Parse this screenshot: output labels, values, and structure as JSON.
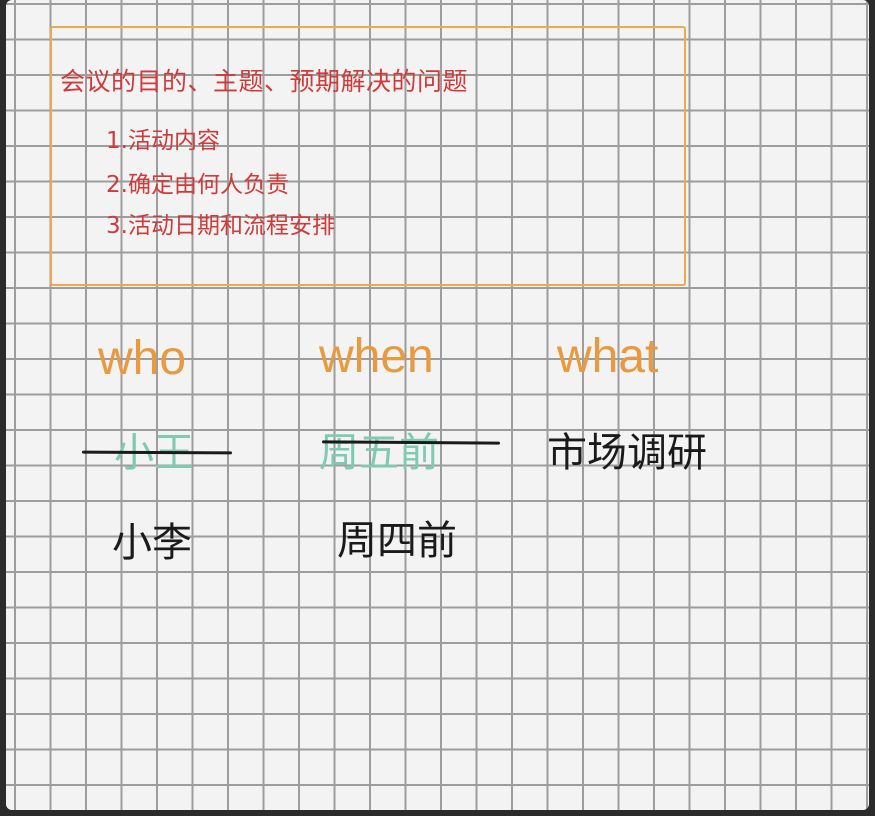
{
  "agenda": {
    "title": "会议的目的、主题、预期解决的问题",
    "items": [
      "1.活动内容",
      "2.确定由何人负责",
      "3.活动日期和流程安排"
    ]
  },
  "columns": {
    "who": "who",
    "when": "when",
    "what": "what"
  },
  "entries": {
    "who_old": "小王",
    "when_old": "周五前",
    "what": "市场调研",
    "who_new": "小李",
    "when_new": "周四前"
  },
  "colors": {
    "box_border": "#eda94a",
    "agenda_text": "#cf3b3b",
    "header_text": "#e79a3f",
    "struck_text": "#7fcab3",
    "ink": "#1a1a1a"
  }
}
